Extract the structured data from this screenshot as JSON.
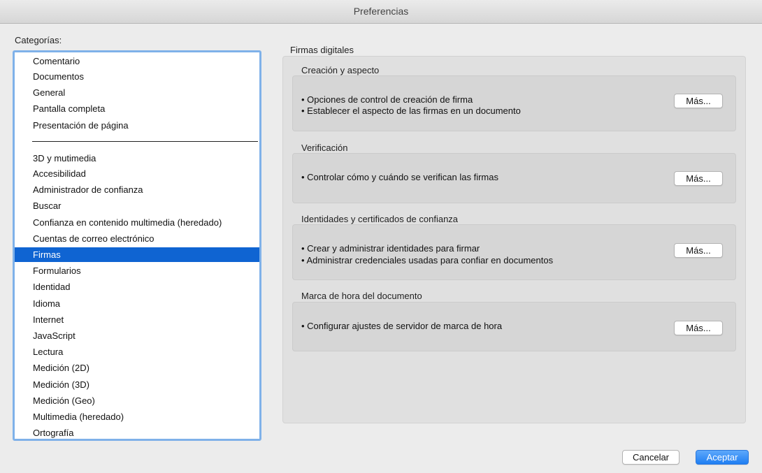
{
  "window": {
    "title": "Preferencias"
  },
  "sidebar": {
    "label": "Categorías:",
    "group1": [
      {
        "label": "Comentario"
      },
      {
        "label": "Documentos"
      },
      {
        "label": "General"
      },
      {
        "label": "Pantalla completa"
      },
      {
        "label": "Presentación de página"
      }
    ],
    "group2": [
      {
        "label": "3D y mutimedia"
      },
      {
        "label": "Accesibilidad"
      },
      {
        "label": "Administrador de confianza"
      },
      {
        "label": "Buscar"
      },
      {
        "label": "Confianza en contenido multimedia (heredado)"
      },
      {
        "label": "Cuentas de correo electrónico"
      },
      {
        "label": "Firmas",
        "selected": true
      },
      {
        "label": "Formularios"
      },
      {
        "label": "Identidad"
      },
      {
        "label": "Idioma"
      },
      {
        "label": "Internet"
      },
      {
        "label": "JavaScript"
      },
      {
        "label": "Lectura"
      },
      {
        "label": "Medición (2D)"
      },
      {
        "label": "Medición (3D)"
      },
      {
        "label": "Medición (Geo)"
      },
      {
        "label": "Multimedia (heredado)"
      },
      {
        "label": "Ortografía"
      }
    ],
    "selected_label": "Firmas"
  },
  "main": {
    "section_title": "Firmas digitales",
    "groups": [
      {
        "title": "Creación y aspecto",
        "bullets": [
          "• Opciones de control de creación de firma",
          "• Establecer el aspecto de las firmas en un documento"
        ],
        "button_label": "Más..."
      },
      {
        "title": "Verificación",
        "bullets": [
          "• Controlar cómo y cuándo se verifican las firmas"
        ],
        "button_label": "Más..."
      },
      {
        "title": "Identidades y certificados de confianza",
        "bullets": [
          "• Crear y administrar identidades para firmar",
          "• Administrar credenciales usadas para confiar en documentos"
        ],
        "button_label": "Más..."
      },
      {
        "title": "Marca de hora del documento",
        "bullets": [
          "• Configurar ajustes de servidor de marca de hora"
        ],
        "button_label": "Más..."
      }
    ]
  },
  "footer": {
    "cancel_label": "Cancelar",
    "accept_label": "Aceptar"
  },
  "colors": {
    "selection": "#0f64d2",
    "list_focus_ring": "#7fb1e9",
    "primary_button": "#1f7ef2"
  }
}
